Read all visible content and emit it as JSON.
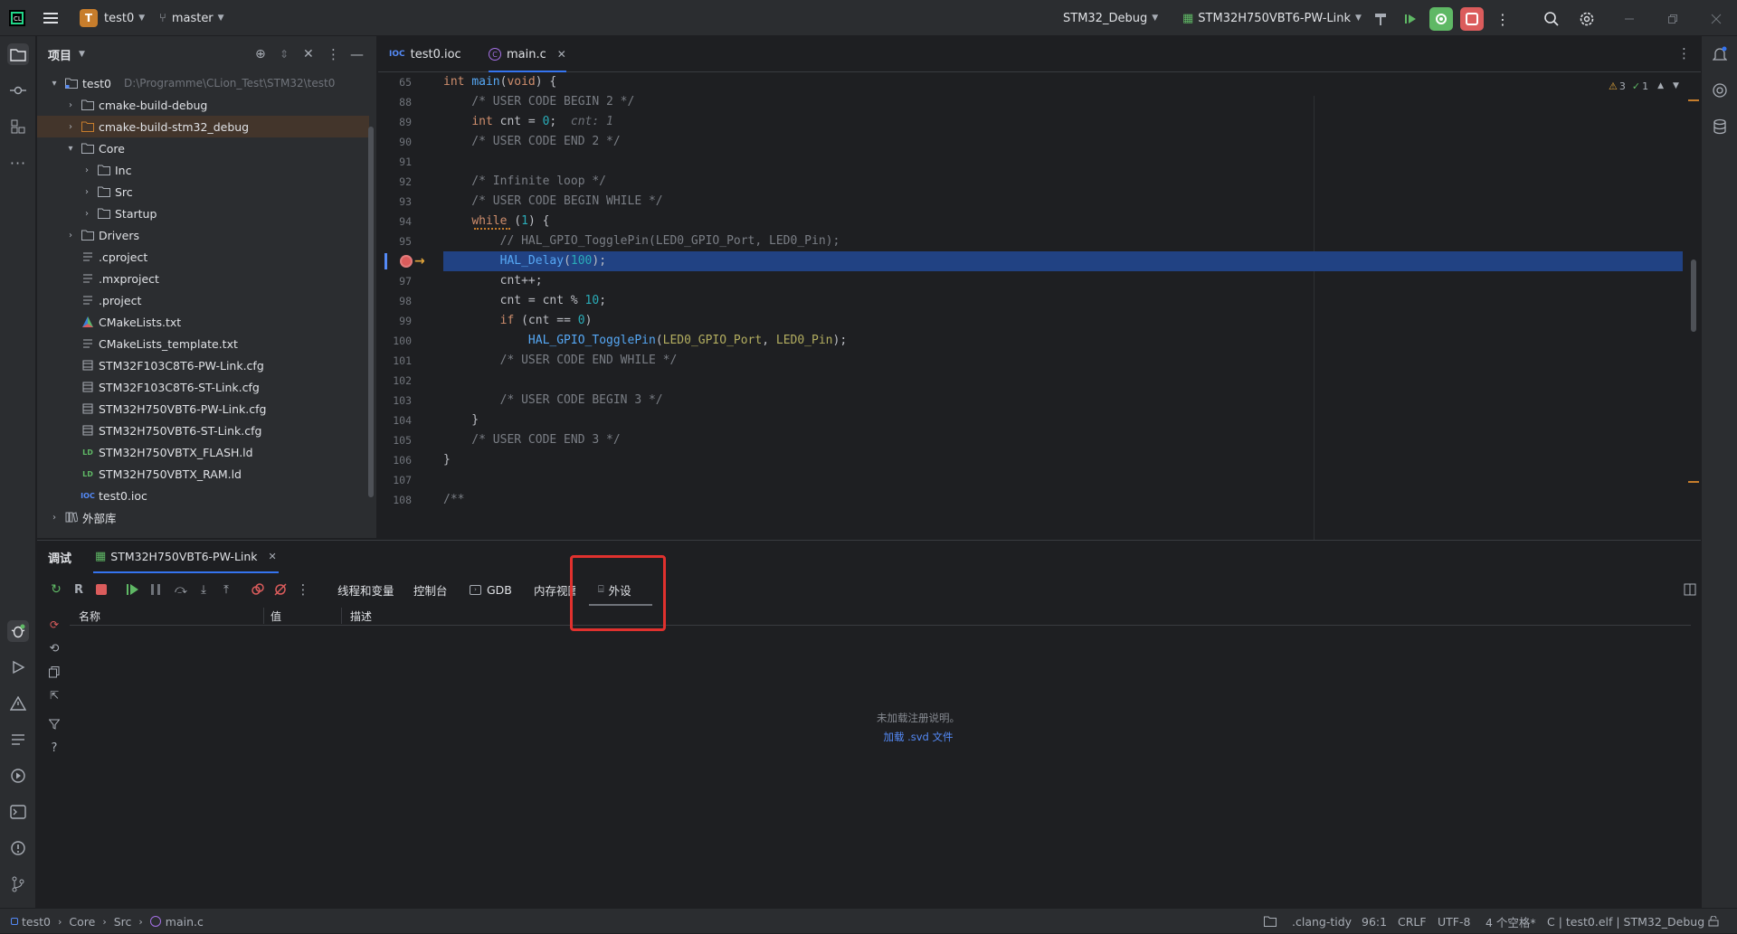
{
  "titlebar": {
    "project_badge": "T",
    "project_name": "test0",
    "branch": "master",
    "run_config": "STM32_Debug",
    "target": "STM32H750VBT6-PW-Link"
  },
  "project_panel": {
    "title": "项目",
    "items": [
      {
        "name": "test0",
        "path": "D:\\Programme\\CLion_Test\\STM32\\test0",
        "type": "root"
      },
      {
        "name": "cmake-build-debug",
        "type": "folder"
      },
      {
        "name": "cmake-build-stm32_debug",
        "type": "folder-excluded"
      },
      {
        "name": "Core",
        "type": "folder"
      },
      {
        "name": "Inc",
        "type": "folder"
      },
      {
        "name": "Src",
        "type": "folder"
      },
      {
        "name": "Startup",
        "type": "folder"
      },
      {
        "name": "Drivers",
        "type": "folder"
      },
      {
        "name": ".cproject",
        "type": "text"
      },
      {
        "name": ".mxproject",
        "type": "text"
      },
      {
        "name": ".project",
        "type": "text"
      },
      {
        "name": "CMakeLists.txt",
        "type": "cmake"
      },
      {
        "name": "CMakeLists_template.txt",
        "type": "text"
      },
      {
        "name": "STM32F103C8T6-PW-Link.cfg",
        "type": "cfg"
      },
      {
        "name": "STM32F103C8T6-ST-Link.cfg",
        "type": "cfg"
      },
      {
        "name": "STM32H750VBT6-PW-Link.cfg",
        "type": "cfg"
      },
      {
        "name": "STM32H750VBT6-ST-Link.cfg",
        "type": "cfg"
      },
      {
        "name": "STM32H750VBTX_FLASH.ld",
        "type": "ld"
      },
      {
        "name": "STM32H750VBTX_RAM.ld",
        "type": "ld"
      },
      {
        "name": "test0.ioc",
        "type": "ioc"
      },
      {
        "name": "外部库",
        "type": "lib"
      }
    ]
  },
  "editor": {
    "tabs": [
      {
        "label": "test0.ioc",
        "icon": "IOC"
      },
      {
        "label": "main.c",
        "icon": "c-file"
      }
    ],
    "inspection": {
      "warnings": "3",
      "ok": "1"
    },
    "lines": [
      {
        "n": "65",
        "code": "int main(void) {"
      },
      {
        "n": "88",
        "code": "    /* USER CODE BEGIN 2 */"
      },
      {
        "n": "89",
        "code": "    int cnt = 0;",
        "hint": "cnt: 1"
      },
      {
        "n": "90",
        "code": "    /* USER CODE END 2 */"
      },
      {
        "n": "91",
        "code": ""
      },
      {
        "n": "92",
        "code": "    /* Infinite loop */"
      },
      {
        "n": "93",
        "code": "    /* USER CODE BEGIN WHILE */"
      },
      {
        "n": "94",
        "code": "    while (1) {"
      },
      {
        "n": "95",
        "code": "        // HAL_GPIO_TogglePin(LED0_GPIO_Port, LED0_Pin);"
      },
      {
        "n": "",
        "code": "        HAL_Delay(100);"
      },
      {
        "n": "97",
        "code": "        cnt++;"
      },
      {
        "n": "98",
        "code": "        cnt = cnt % 10;"
      },
      {
        "n": "99",
        "code": "        if (cnt == 0)"
      },
      {
        "n": "100",
        "code": "            HAL_GPIO_TogglePin(LED0_GPIO_Port, LED0_Pin);"
      },
      {
        "n": "101",
        "code": "        /* USER CODE END WHILE */"
      },
      {
        "n": "102",
        "code": ""
      },
      {
        "n": "103",
        "code": "        /* USER CODE BEGIN 3 */"
      },
      {
        "n": "104",
        "code": "    }"
      },
      {
        "n": "105",
        "code": "    /* USER CODE END 3 */"
      },
      {
        "n": "106",
        "code": "}"
      },
      {
        "n": "107",
        "code": ""
      },
      {
        "n": "108",
        "code": "/**"
      }
    ],
    "breadcrumb": "main"
  },
  "debug_panel": {
    "title": "调试",
    "session": "STM32H750VBT6-PW-Link",
    "tabs": [
      "线程和变量",
      "控制台",
      "GDB",
      "内存视图",
      "外设"
    ],
    "columns": [
      "名称",
      "值",
      "描述"
    ],
    "empty_text": "未加载注册说明。",
    "load_link": "加载 .svd 文件"
  },
  "statusbar": {
    "crumbs": [
      "test0",
      "Core",
      "Src",
      "main.c"
    ],
    "linter": ".clang-tidy",
    "position": "96:1",
    "line_sep": "CRLF",
    "encoding": "UTF-8",
    "indent": "4 个空格*",
    "context": "C | test0.elf | STM32_Debug"
  },
  "colors": {
    "accent": "#3574f0",
    "highlight": "#214283",
    "annotation": "#e0312e"
  }
}
